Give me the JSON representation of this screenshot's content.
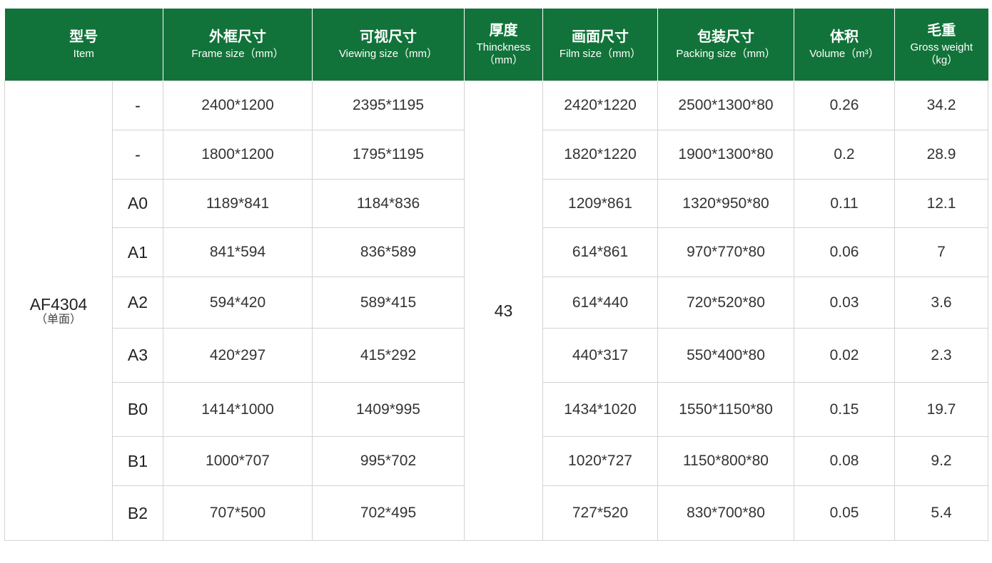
{
  "header": {
    "item_zh": "型号",
    "item_en": "Item",
    "frame_zh": "外框尺寸",
    "frame_en": "Frame size（mm）",
    "view_zh": "可视尺寸",
    "view_en": "Viewing size（mm）",
    "thick_zh": "厚度",
    "thick_en": "Thinckness",
    "thick_unit": "（mm）",
    "film_zh": "画面尺寸",
    "film_en": "Film size（mm）",
    "pack_zh": "包装尺寸",
    "pack_en": "Packing size（mm）",
    "vol_zh": "体积",
    "vol_en": "Volume（m³）",
    "gw_zh": "毛重",
    "gw_en": "Gross weight",
    "gw_unit": "（kg）"
  },
  "model": {
    "name": "AF4304",
    "note": "（单面）"
  },
  "thickness": "43",
  "rows": [
    {
      "variant": "-",
      "frame": "2400*1200",
      "view": "2395*1195",
      "film": "2420*1220",
      "pack": "2500*1300*80",
      "vol": "0.26",
      "gw": "34.2"
    },
    {
      "variant": "-",
      "frame": "1800*1200",
      "view": "1795*1195",
      "film": "1820*1220",
      "pack": "1900*1300*80",
      "vol": "0.2",
      "gw": "28.9"
    },
    {
      "variant": "A0",
      "frame": "1189*841",
      "view": "1184*836",
      "film": "1209*861",
      "pack": "1320*950*80",
      "vol": "0.11",
      "gw": "12.1"
    },
    {
      "variant": "A1",
      "frame": "841*594",
      "view": "836*589",
      "film": "614*861",
      "pack": "970*770*80",
      "vol": "0.06",
      "gw": "7"
    },
    {
      "variant": "A2",
      "frame": "594*420",
      "view": "589*415",
      "film": "614*440",
      "pack": "720*520*80",
      "vol": "0.03",
      "gw": "3.6"
    },
    {
      "variant": "A3",
      "frame": "420*297",
      "view": "415*292",
      "film": "440*317",
      "pack": "550*400*80",
      "vol": "0.02",
      "gw": "2.3"
    },
    {
      "variant": "B0",
      "frame": "1414*1000",
      "view": "1409*995",
      "film": "1434*1020",
      "pack": "1550*1150*80",
      "vol": "0.15",
      "gw": "19.7"
    },
    {
      "variant": "B1",
      "frame": "1000*707",
      "view": "995*702",
      "film": "1020*727",
      "pack": "1150*800*80",
      "vol": "0.08",
      "gw": "9.2"
    },
    {
      "variant": "B2",
      "frame": "707*500",
      "view": "702*495",
      "film": "727*520",
      "pack": "830*700*80",
      "vol": "0.05",
      "gw": "5.4"
    }
  ],
  "colors": {
    "header_bg": "#12733a",
    "header_text": "#ffffff",
    "grid": "#d3d3d3",
    "text": "#333333"
  }
}
